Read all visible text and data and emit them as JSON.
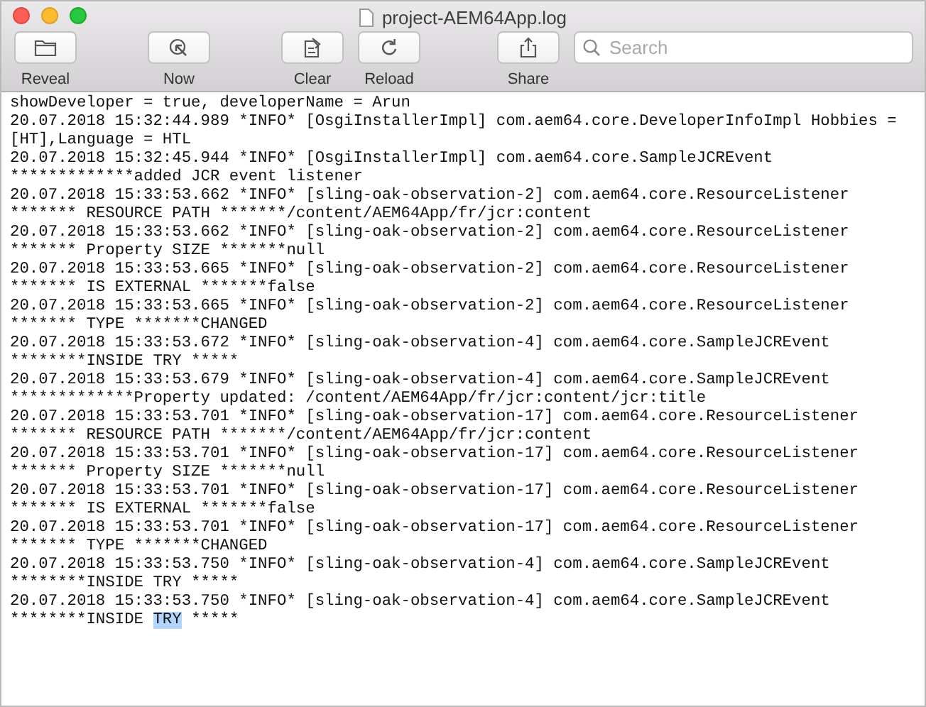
{
  "window": {
    "title": "project-AEM64App.log"
  },
  "toolbar": {
    "buttons": [
      {
        "label": "Reveal",
        "kind": "folder"
      },
      {
        "label": "Now",
        "kind": "cursor"
      },
      {
        "label": "Clear",
        "kind": "clear"
      },
      {
        "label": "Reload",
        "kind": "reload"
      },
      {
        "label": "Share",
        "kind": "share"
      }
    ]
  },
  "search": {
    "placeholder": "Search"
  },
  "log": {
    "lines": [
      {
        "text": "showDeveloper = true, developerName = Arun"
      },
      {
        "text": "20.07.2018 15:32:44.989 *INFO* [OsgiInstallerImpl] com.aem64.core.DeveloperInfoImpl Hobbies ="
      },
      {
        "text": "[HT],Language = HTL"
      },
      {
        "text": "20.07.2018 15:32:45.944 *INFO* [OsgiInstallerImpl] com.aem64.core.SampleJCREvent"
      },
      {
        "text": "*************added JCR event listener"
      },
      {
        "text": "20.07.2018 15:33:53.662 *INFO* [sling-oak-observation-2] com.aem64.core.ResourceListener"
      },
      {
        "text": "******* RESOURCE PATH *******/content/AEM64App/fr/jcr:content"
      },
      {
        "text": "20.07.2018 15:33:53.662 *INFO* [sling-oak-observation-2] com.aem64.core.ResourceListener"
      },
      {
        "text": "******* Property SIZE *******null"
      },
      {
        "text": "20.07.2018 15:33:53.665 *INFO* [sling-oak-observation-2] com.aem64.core.ResourceListener"
      },
      {
        "text": "******* IS EXTERNAL *******false"
      },
      {
        "text": "20.07.2018 15:33:53.665 *INFO* [sling-oak-observation-2] com.aem64.core.ResourceListener"
      },
      {
        "text": "******* TYPE *******CHANGED"
      },
      {
        "text": "20.07.2018 15:33:53.672 *INFO* [sling-oak-observation-4] com.aem64.core.SampleJCREvent"
      },
      {
        "text": "********INSIDE TRY *****"
      },
      {
        "text": "20.07.2018 15:33:53.679 *INFO* [sling-oak-observation-4] com.aem64.core.SampleJCREvent"
      },
      {
        "text": "*************Property updated: /content/AEM64App/fr/jcr:content/jcr:title"
      },
      {
        "text": "20.07.2018 15:33:53.701 *INFO* [sling-oak-observation-17] com.aem64.core.ResourceListener"
      },
      {
        "text": "******* RESOURCE PATH *******/content/AEM64App/fr/jcr:content"
      },
      {
        "text": "20.07.2018 15:33:53.701 *INFO* [sling-oak-observation-17] com.aem64.core.ResourceListener"
      },
      {
        "text": "******* Property SIZE *******null"
      },
      {
        "text": "20.07.2018 15:33:53.701 *INFO* [sling-oak-observation-17] com.aem64.core.ResourceListener"
      },
      {
        "text": "******* IS EXTERNAL *******false"
      },
      {
        "text": "20.07.2018 15:33:53.701 *INFO* [sling-oak-observation-17] com.aem64.core.ResourceListener"
      },
      {
        "text": "******* TYPE *******CHANGED"
      },
      {
        "text": "20.07.2018 15:33:53.750 *INFO* [sling-oak-observation-4] com.aem64.core.SampleJCREvent"
      },
      {
        "text": "********INSIDE TRY *****"
      },
      {
        "text": "20.07.2018 15:33:53.750 *INFO* [sling-oak-observation-4] com.aem64.core.SampleJCREvent"
      },
      {
        "parts": [
          {
            "text": "********INSIDE ",
            "selected": false
          },
          {
            "text": "TRY",
            "selected": true
          },
          {
            "text": " *****",
            "selected": false
          }
        ]
      }
    ]
  }
}
